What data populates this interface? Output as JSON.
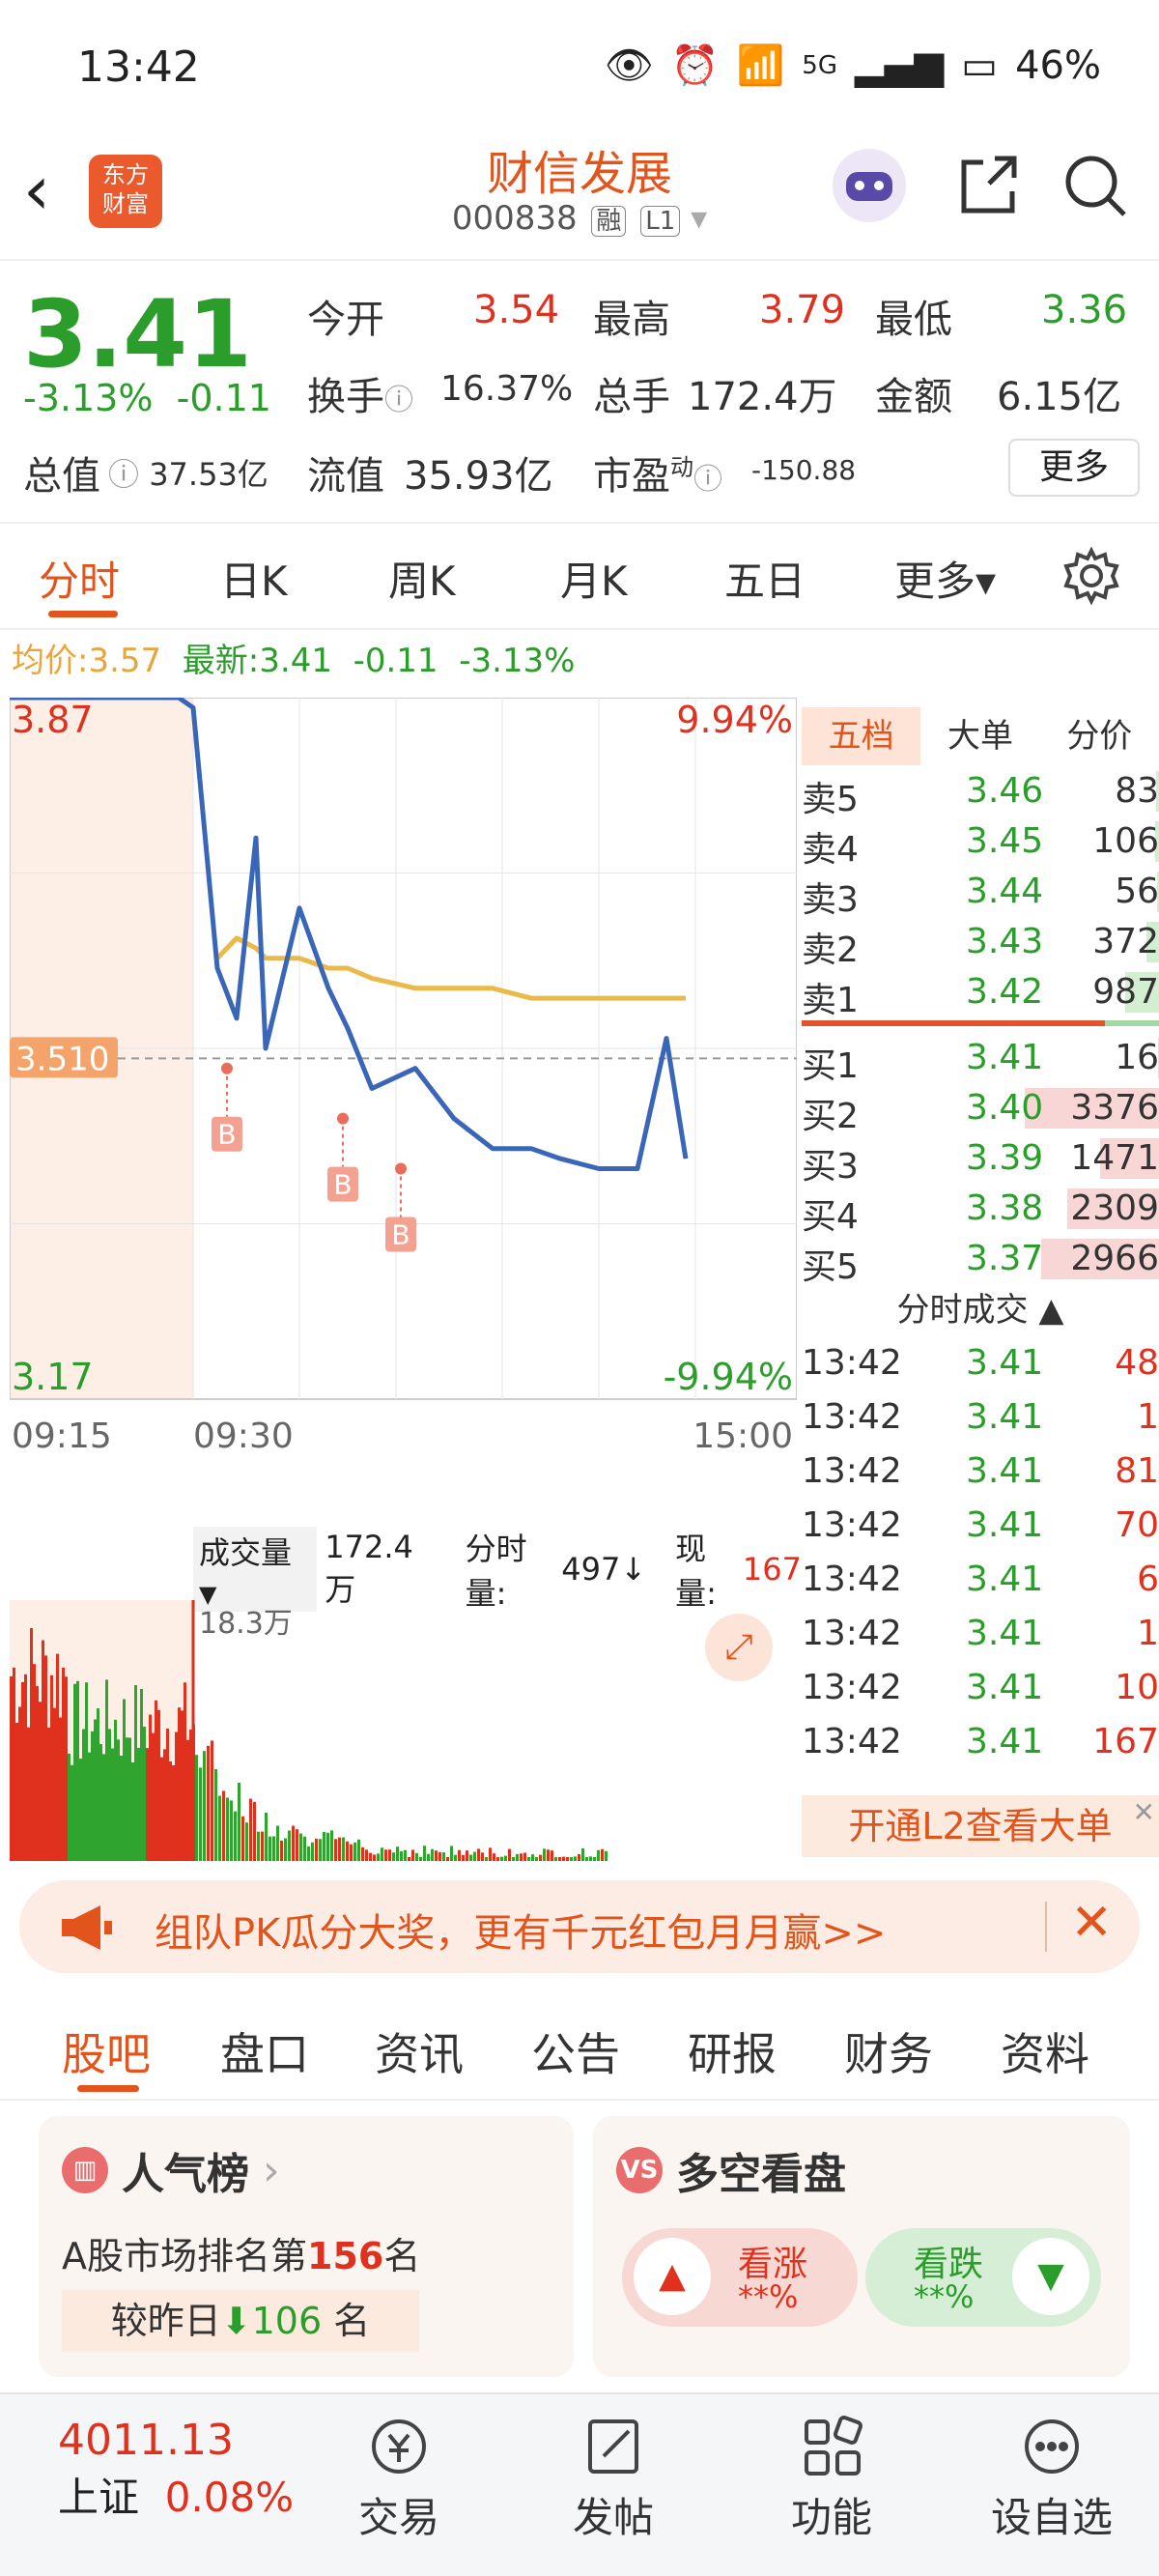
{
  "status_bar": {
    "time": "13:42",
    "network": "5G",
    "battery": "46%"
  },
  "header": {
    "back_icon": "chevron-left-icon",
    "logo_text_1": "东方",
    "logo_text_2": "财富",
    "title": "财信发展",
    "code": "000838",
    "tag_margin": "融",
    "tag_level": "L1"
  },
  "quote": {
    "price": "3.41",
    "change_pct": "-3.13%",
    "change_abs": "-0.11",
    "open_label": "今开",
    "open": "3.54",
    "high_label": "最高",
    "high": "3.79",
    "low_label": "最低",
    "low": "3.36",
    "turnover_label": "换手",
    "turnover": "16.37%",
    "volume_label": "总手",
    "volume": "172.4万",
    "amount_label": "金额",
    "amount": "6.15亿",
    "mktcap_label": "总值",
    "mktcap": "37.53亿",
    "float_label": "流值",
    "float_cap": "35.93亿",
    "pe_label": "市盈",
    "pe_sup": "动",
    "pe": "-150.88",
    "more_btn": "更多"
  },
  "period_tabs": [
    "分时",
    "日K",
    "周K",
    "月K",
    "五日",
    "更多▾"
  ],
  "avg_line": {
    "avg_label": "均价:",
    "avg": "3.57",
    "latest_label": "最新:",
    "latest": "3.41",
    "chg": "-0.11",
    "pct": "-3.13%"
  },
  "intraday": {
    "y_top": "3.87",
    "y_bottom": "3.17",
    "pct_top": "9.94%",
    "pct_bottom": "-9.94%",
    "ref_price": "3.510",
    "times": [
      "09:15",
      "09:30",
      "15:00"
    ],
    "buy_marker": "B"
  },
  "chart_data": {
    "type": "line",
    "title": "",
    "xlabel": "",
    "ylabel": "",
    "ylim": [
      3.17,
      3.87
    ],
    "x": [
      "09:15",
      "09:25",
      "09:30",
      "09:35",
      "09:40",
      "09:45",
      "09:50",
      "10:00",
      "10:10",
      "10:20",
      "10:30",
      "10:45",
      "11:00",
      "11:15",
      "11:30",
      "13:00",
      "13:15",
      "13:30",
      "13:40",
      "13:42"
    ],
    "series": [
      {
        "name": "",
        "values": [
          3.87,
          3.87,
          3.86,
          3.6,
          3.55,
          3.73,
          3.52,
          3.66,
          3.58,
          3.54,
          3.48,
          3.5,
          3.45,
          3.42,
          3.42,
          3.41,
          3.4,
          3.4,
          3.53,
          3.41
        ]
      },
      {
        "name": "",
        "values": [
          null,
          null,
          null,
          3.61,
          3.63,
          3.62,
          3.61,
          3.61,
          3.6,
          3.6,
          3.59,
          3.58,
          3.58,
          3.58,
          3.57,
          3.57,
          3.57,
          3.57,
          3.57,
          3.57
        ]
      }
    ]
  },
  "volume": {
    "label": "成交量",
    "total": "172.4万",
    "minute_label": "分时量:",
    "minute": "497",
    "current_label": "现量:",
    "current": "167",
    "max": "18.3万"
  },
  "order_book": {
    "tabs": [
      "五档",
      "大单",
      "分价"
    ],
    "asks": [
      {
        "name": "卖5",
        "price": "3.46",
        "vol": "83"
      },
      {
        "name": "卖4",
        "price": "3.45",
        "vol": "106"
      },
      {
        "name": "卖3",
        "price": "3.44",
        "vol": "56"
      },
      {
        "name": "卖2",
        "price": "3.43",
        "vol": "372"
      },
      {
        "name": "卖1",
        "price": "3.42",
        "vol": "987"
      }
    ],
    "bids": [
      {
        "name": "买1",
        "price": "3.41",
        "vol": "16"
      },
      {
        "name": "买2",
        "price": "3.40",
        "vol": "3376"
      },
      {
        "name": "买3",
        "price": "3.39",
        "vol": "1471"
      },
      {
        "name": "买4",
        "price": "3.38",
        "vol": "2309"
      },
      {
        "name": "买5",
        "price": "3.37",
        "vol": "2966"
      }
    ],
    "ticks_label": "分时成交 ▲",
    "ticks": [
      {
        "time": "13:42",
        "price": "3.41",
        "vol": "48"
      },
      {
        "time": "13:42",
        "price": "3.41",
        "vol": "1"
      },
      {
        "time": "13:42",
        "price": "3.41",
        "vol": "81"
      },
      {
        "time": "13:42",
        "price": "3.41",
        "vol": "70"
      },
      {
        "time": "13:42",
        "price": "3.41",
        "vol": "6"
      },
      {
        "time": "13:42",
        "price": "3.41",
        "vol": "1"
      },
      {
        "time": "13:42",
        "price": "3.41",
        "vol": "10"
      },
      {
        "time": "13:42",
        "price": "3.41",
        "vol": "167"
      }
    ],
    "l2_banner": "开通L2查看大单"
  },
  "banner": {
    "text": "组队PK瓜分大奖，更有千元红包月月赢>>"
  },
  "content_tabs": [
    "股吧",
    "盘口",
    "资讯",
    "公告",
    "研报",
    "财务",
    "资料"
  ],
  "popularity": {
    "title": "人气榜",
    "rank_prefix": "A股市场排名第",
    "rank": "156",
    "rank_suffix": "名",
    "change_prefix": "较昨日",
    "change": "106",
    "change_suffix": "名"
  },
  "long_short": {
    "title": "多空看盘",
    "up_label": "看涨",
    "up_val": "**%",
    "down_label": "看跌",
    "down_val": "**%"
  },
  "bottom_nav": {
    "index_value": "4011.13",
    "index_name": "上证",
    "index_pct": "0.08%",
    "items": [
      "交易",
      "发帖",
      "功能",
      "设自选"
    ]
  },
  "colors": {
    "accent": "#e2541c",
    "up": "#e0301e",
    "down": "#2a9d2a",
    "line": "#3a66b8",
    "avg": "#e9b94a"
  }
}
